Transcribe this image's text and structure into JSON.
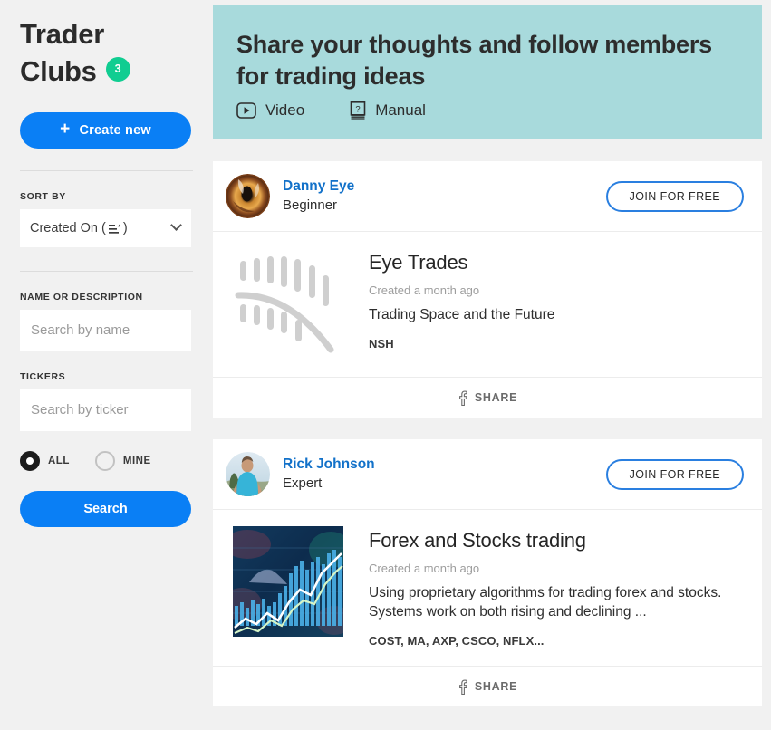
{
  "sidebar": {
    "title_line1": "Trader",
    "title_line2": "Clubs",
    "badge_count": "3",
    "create_label": "Create new",
    "sort_label": "SORT BY",
    "sort_value": "Created On (",
    "sort_value_suffix": ")",
    "name_label": "NAME OR DESCRIPTION",
    "name_placeholder": "Search by name",
    "name_value": "",
    "ticker_label": "TICKERS",
    "ticker_placeholder": "Search by ticker",
    "ticker_value": "",
    "radio_all": "ALL",
    "radio_mine": "MINE",
    "selected_radio": "ALL",
    "search_label": "Search",
    "accent_blue": "#0a7ff5",
    "badge_green": "#10cd91"
  },
  "banner": {
    "heading": "Share your thoughts and follow members for trading ideas",
    "video_label": "Video",
    "manual_label": "Manual",
    "background": "#a8dadc"
  },
  "clubs": [
    {
      "author_name": "Danny Eye",
      "author_level": "Beginner",
      "join_label": "JOIN FOR FREE",
      "name": "Eye Trades",
      "created": "Created a month ago",
      "description": "Trading Space and the Future",
      "tickers": "NSH",
      "share_label": "SHARE",
      "avatar_type": "eye-photo",
      "thumb_type": "gray-feather-placeholder"
    },
    {
      "author_name": "Rick Johnson",
      "author_level": "Expert",
      "join_label": "JOIN FOR FREE",
      "name": "Forex and Stocks trading",
      "created": "Created a month ago",
      "description": "Using proprietary algorithms for trading forex and stocks. Systems work on both rising and declining ...",
      "tickers": "COST, MA, AXP, CSCO, NFLX...",
      "share_label": "SHARE",
      "avatar_type": "man-outdoors-photo",
      "thumb_type": "blue-stock-chart"
    }
  ]
}
